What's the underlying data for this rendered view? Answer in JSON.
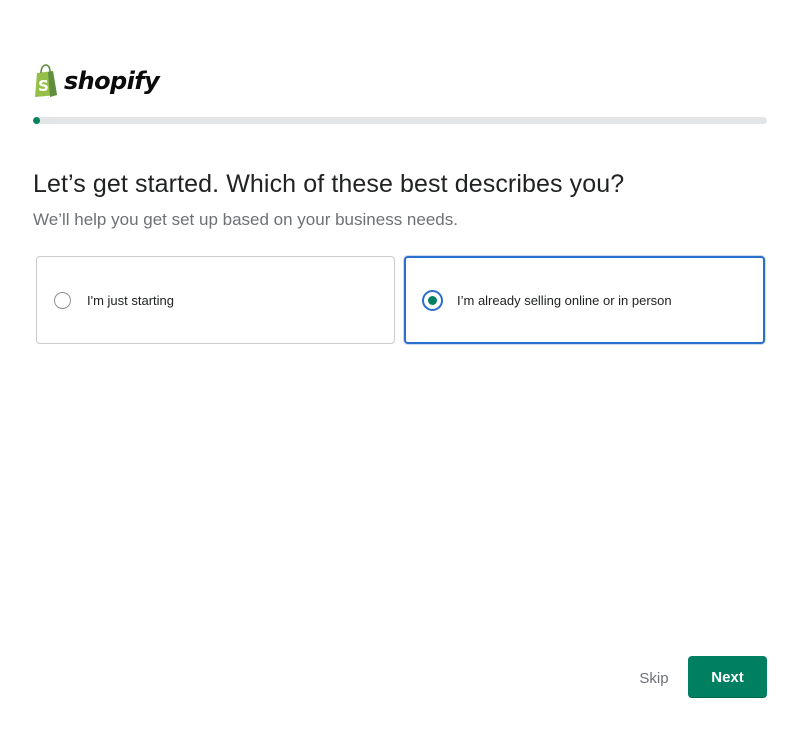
{
  "brand": {
    "name": "shopify",
    "logo_icon": "shopify-bag-icon",
    "accent_color": "#008060"
  },
  "progress": {
    "percent": 1,
    "color": "#008060"
  },
  "heading": {
    "title": "Let’s get started. Which of these best describes you?",
    "subtitle": "We’ll help you get set up based on your business needs."
  },
  "options": [
    {
      "label": "I'm just starting",
      "selected": false
    },
    {
      "label": "I’m already selling online or in person",
      "selected": true
    }
  ],
  "selection_border_color": "#2c6ecb",
  "footer": {
    "skip_label": "Skip",
    "next_label": "Next"
  }
}
